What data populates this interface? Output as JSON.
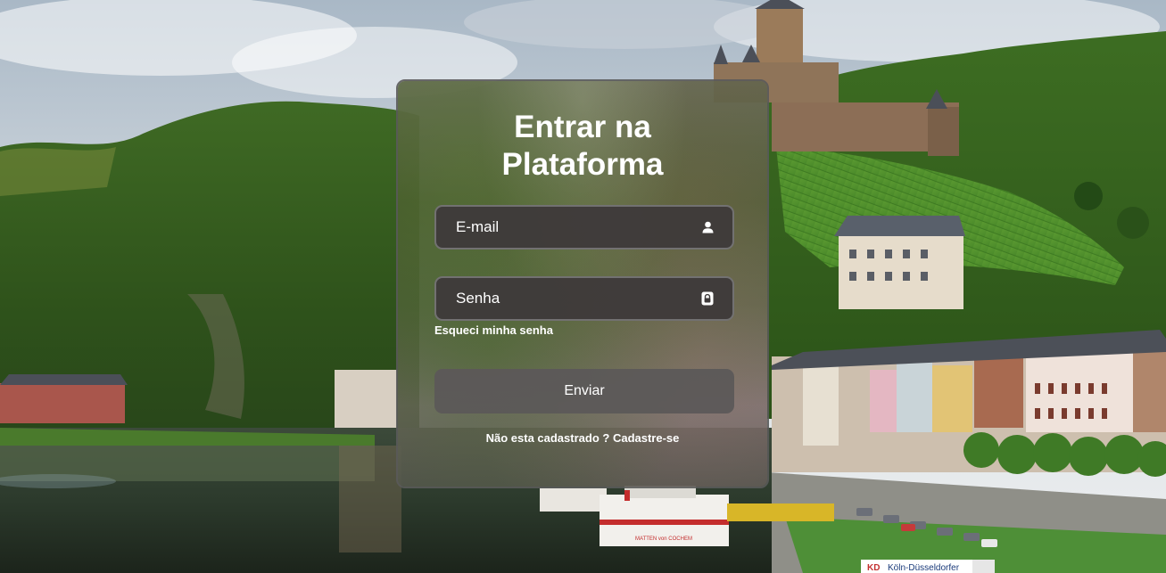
{
  "background": {
    "description_icon": "landscape-photo",
    "sign_text": "Köln-Düsseldorfer",
    "sign_prefix": "KD",
    "boat_text": "MATTEN von COCHEM"
  },
  "login": {
    "title_line1": "Entrar na",
    "title_line2": "Plataforma",
    "email_placeholder": "E-mail",
    "email_icon": "user-icon",
    "password_placeholder": "Senha",
    "password_icon": "lock-icon",
    "forgot_password": "Esqueci minha senha",
    "submit_label": "Enviar",
    "register_prompt": "Não esta cadastrado ?",
    "register_link": "Cadastre-se"
  },
  "colors": {
    "text": "#ffffff",
    "field_bg": "#3e3a3a",
    "button_bg": "#5c5858"
  }
}
